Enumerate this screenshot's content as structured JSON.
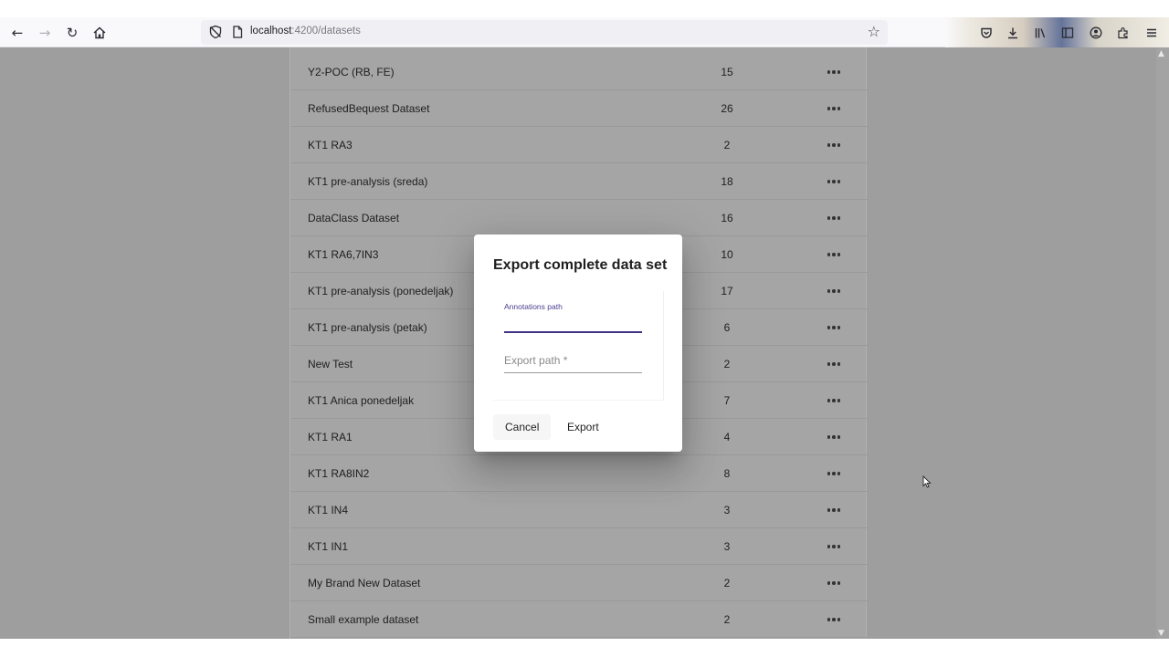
{
  "browser": {
    "url_host": "localhost",
    "url_path": ":4200/datasets",
    "icons": [
      "back-icon",
      "forward-icon",
      "reload-icon",
      "home-icon",
      "tracking-shield-icon",
      "page-info-icon",
      "bookmark-star-icon",
      "pocket-icon",
      "downloads-icon",
      "library-icon",
      "sidebar-icon",
      "account-icon",
      "extensions-icon",
      "menu-icon"
    ]
  },
  "datasets": [
    {
      "name": "Y2-POC (RB, FE)",
      "count": "15"
    },
    {
      "name": "RefusedBequest Dataset",
      "count": "26"
    },
    {
      "name": "KT1 RA3",
      "count": "2"
    },
    {
      "name": "KT1 pre-analysis (sreda)",
      "count": "18"
    },
    {
      "name": "DataClass Dataset",
      "count": "16"
    },
    {
      "name": "KT1 RA6,7IN3",
      "count": "10"
    },
    {
      "name": "KT1 pre-analysis (ponedeljak)",
      "count": "17"
    },
    {
      "name": "KT1 pre-analysis (petak)",
      "count": "6"
    },
    {
      "name": "New Test",
      "count": "2"
    },
    {
      "name": "KT1 Anica ponedeljak",
      "count": "7"
    },
    {
      "name": "KT1 RA1",
      "count": "4"
    },
    {
      "name": "KT1 RA8IN2",
      "count": "8"
    },
    {
      "name": "KT1 IN4",
      "count": "3"
    },
    {
      "name": "KT1 IN1",
      "count": "3"
    },
    {
      "name": "My Brand New Dataset",
      "count": "2"
    },
    {
      "name": "Small example dataset",
      "count": "2"
    }
  ],
  "dialog": {
    "title": "Export complete data set",
    "annotations_label": "Annotations path",
    "annotations_value": "",
    "export_placeholder": "Export path *",
    "export_value": "",
    "cancel_label": "Cancel",
    "export_label": "Export"
  },
  "colors": {
    "accent": "#3f3385",
    "backdrop": "#9e9e9e"
  }
}
